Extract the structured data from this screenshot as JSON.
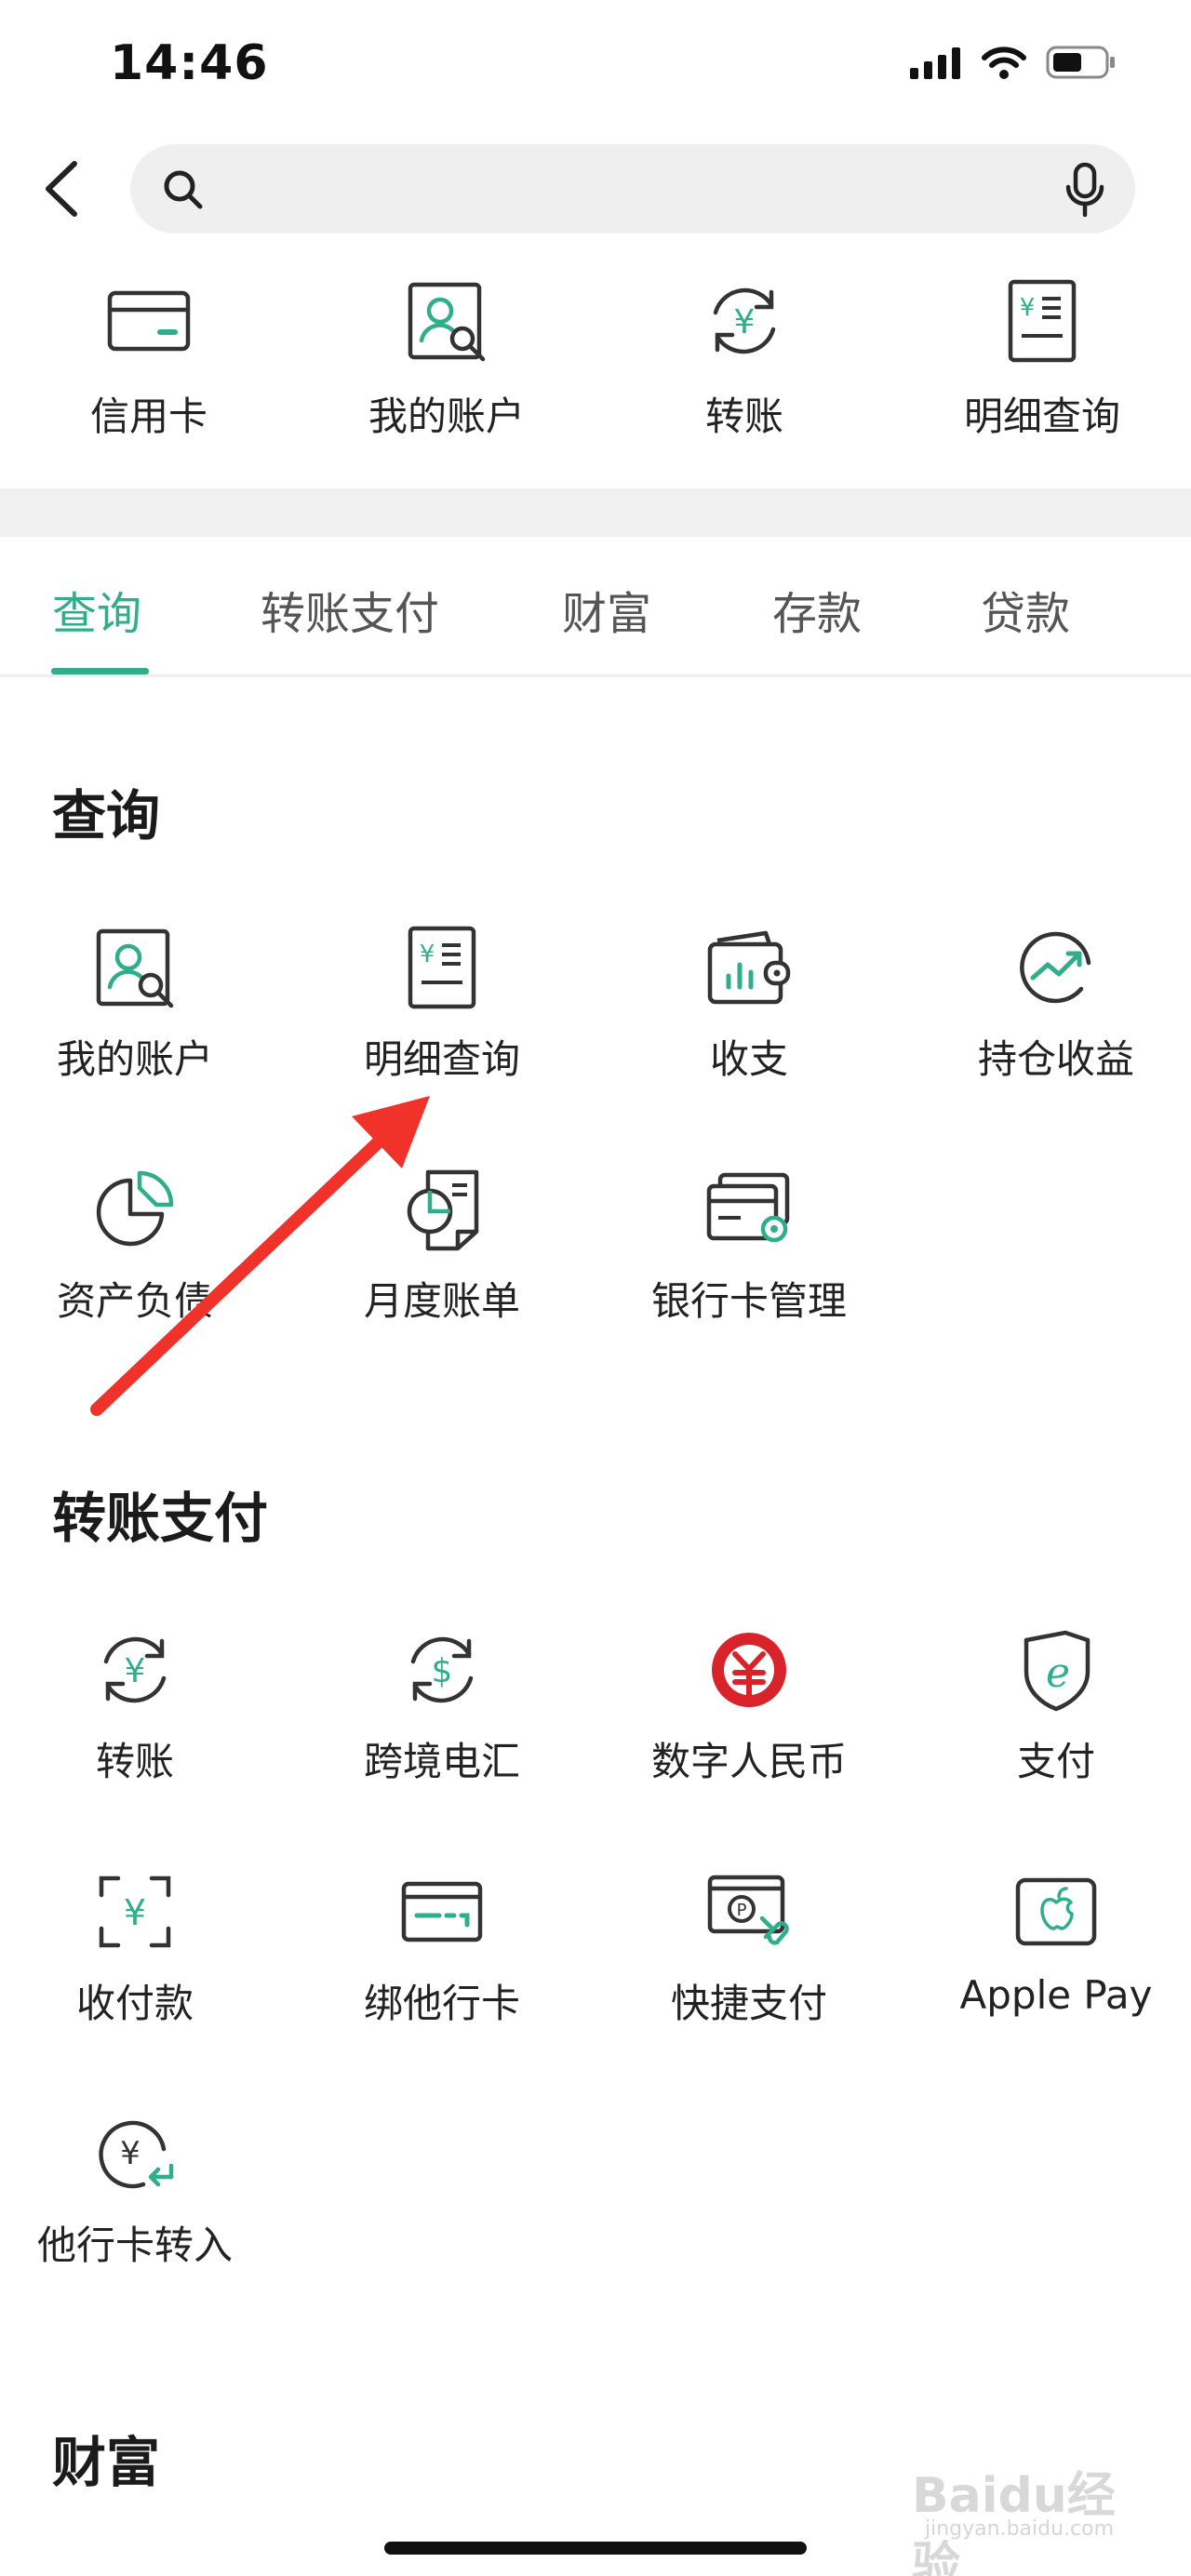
{
  "status_bar": {
    "time": "14:46"
  },
  "search": {
    "placeholder": ""
  },
  "top_shortcuts": [
    {
      "label": "信用卡",
      "icon": "credit-card-icon"
    },
    {
      "label": "我的账户",
      "icon": "account-search-icon"
    },
    {
      "label": "转账",
      "icon": "transfer-yuan-icon"
    },
    {
      "label": "明细查询",
      "icon": "detail-bill-icon"
    }
  ],
  "tabs": [
    {
      "label": "查询",
      "active": true
    },
    {
      "label": "转账支付",
      "active": false
    },
    {
      "label": "财富",
      "active": false
    },
    {
      "label": "存款",
      "active": false
    },
    {
      "label": "贷款",
      "active": false
    }
  ],
  "sections": {
    "query": {
      "title": "查询",
      "items": [
        {
          "label": "我的账户",
          "icon": "account-search-icon"
        },
        {
          "label": "明细查询",
          "icon": "detail-bill-icon"
        },
        {
          "label": "收支",
          "icon": "wallet-chart-icon"
        },
        {
          "label": "持仓收益",
          "icon": "trend-up-icon"
        },
        {
          "label": "资产负债",
          "icon": "pie-chart-icon"
        },
        {
          "label": "月度账单",
          "icon": "monthly-bill-icon"
        },
        {
          "label": "银行卡管理",
          "icon": "card-settings-icon"
        }
      ]
    },
    "transfer_pay": {
      "title": "转账支付",
      "items": [
        {
          "label": "转账",
          "icon": "transfer-yuan-icon"
        },
        {
          "label": "跨境电汇",
          "icon": "cross-border-dollar-icon"
        },
        {
          "label": "数字人民币",
          "icon": "digital-rmb-icon"
        },
        {
          "label": "支付",
          "icon": "e-pay-shield-icon"
        },
        {
          "label": "收付款",
          "icon": "scan-yuan-icon"
        },
        {
          "label": "绑他行卡",
          "icon": "bind-card-icon"
        },
        {
          "label": "快捷支付",
          "icon": "quick-pay-icon"
        },
        {
          "label": "Apple Pay",
          "icon": "apple-pay-icon"
        },
        {
          "label": "他行卡转入",
          "icon": "other-card-in-icon"
        }
      ]
    },
    "wealth": {
      "title": "财富"
    }
  },
  "watermark": {
    "text": "Baidu经验",
    "sub": "jingyan.baidu.com"
  },
  "colors": {
    "accent": "#2fae8c",
    "annotation_arrow": "#f0322a",
    "digital_rmb_red": "#d8232a"
  }
}
